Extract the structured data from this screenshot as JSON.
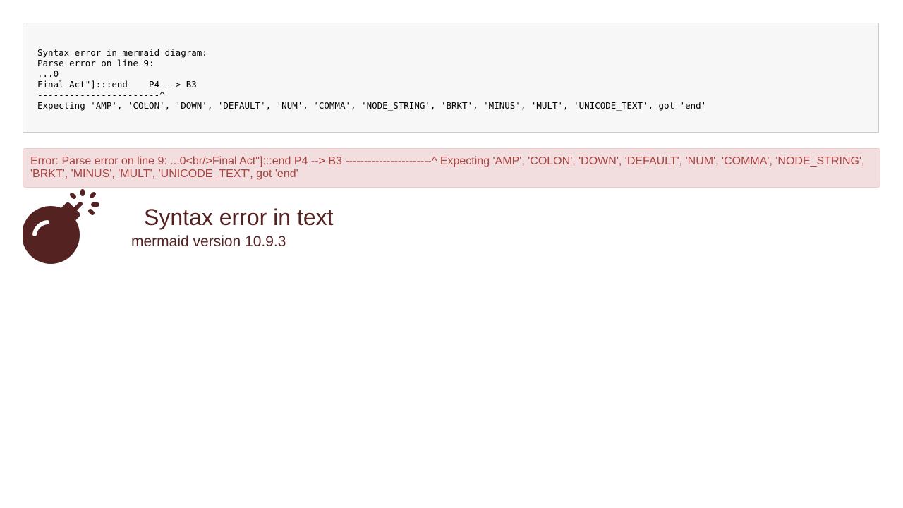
{
  "code_block": {
    "lines": [
      "Syntax error in mermaid diagram:",
      "Parse error on line 9:",
      "...0",
      "Final Act\"]:::end    P4 --> B3",
      "-----------------------^",
      "Expecting 'AMP', 'COLON', 'DOWN', 'DEFAULT', 'NUM', 'COMMA', 'NODE_STRING', 'BRKT', 'MINUS', 'MULT', 'UNICODE_TEXT', got 'end'"
    ]
  },
  "alert": {
    "text": "Error: Parse error on line 9: ...0<br/>Final Act\"]:::end P4 --> B3 -----------------------^ Expecting 'AMP', 'COLON', 'DOWN', 'DEFAULT', 'NUM', 'COMMA', 'NODE_STRING', 'BRKT', 'MINUS', 'MULT', 'UNICODE_TEXT', got 'end'"
  },
  "error_panel": {
    "icon": "bomb-icon",
    "title": "Syntax error in text",
    "version": "mermaid version 10.9.3"
  },
  "colors": {
    "code_background": "#f7f7f7",
    "alert_background": "#f2dede",
    "alert_text": "#a94442",
    "error_color": "#552222"
  }
}
